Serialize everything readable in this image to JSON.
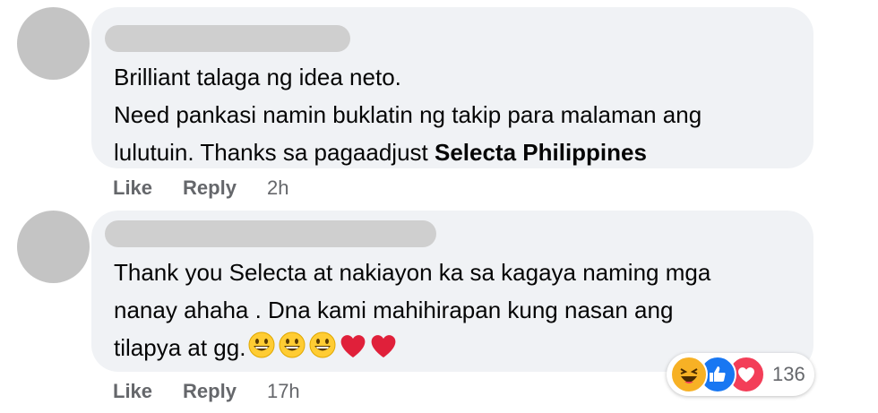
{
  "comments": [
    {
      "text_lines": [
        "Brilliant talaga ng idea neto.",
        "Need pankasi namin buklatin ng takip para malaman ang",
        "lulutuin. Thanks sa pagaadjust "
      ],
      "mention": "Selecta Philippines",
      "actions": {
        "like": "Like",
        "reply": "Reply",
        "time": "2h"
      }
    },
    {
      "text_lines": [
        "Thank you Selecta at nakiayon ka sa kagaya naming mga",
        "nanay ahaha . Dna kami mahihirapan kung nasan ang",
        "tilapya at gg."
      ],
      "emojis": [
        "grinning-face",
        "grinning-face",
        "grinning-face",
        "red-heart",
        "red-heart"
      ],
      "actions": {
        "like": "Like",
        "reply": "Reply",
        "time": "17h"
      },
      "reactions": {
        "icons": [
          "haha-icon",
          "like-icon",
          "love-icon"
        ],
        "count": "136"
      }
    }
  ],
  "colors": {
    "bubble": "#f0f2f5",
    "avatar": "#c4c4c4",
    "redacted_name": "#cfcfcf",
    "action_text": "#65676b",
    "like_blue": "#1877f2",
    "love_red": "#f33e58",
    "haha_yellow": "#f7b125"
  }
}
